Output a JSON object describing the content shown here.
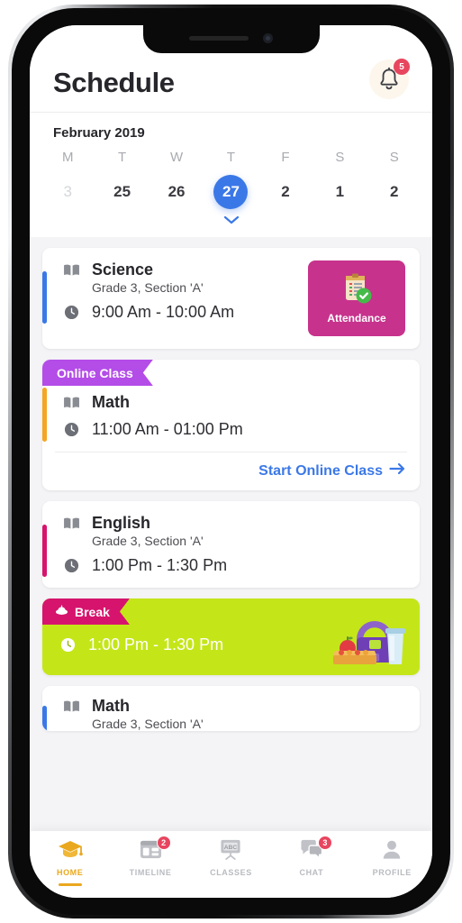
{
  "header": {
    "title": "Schedule",
    "bell_icon": "bell-icon",
    "notification_count": "5"
  },
  "calendar": {
    "month_label": "February 2019",
    "day_initials": [
      "M",
      "T",
      "W",
      "T",
      "F",
      "S",
      "S"
    ],
    "dates": [
      {
        "label": "3",
        "state": "muted"
      },
      {
        "label": "25",
        "state": "normal"
      },
      {
        "label": "26",
        "state": "normal"
      },
      {
        "label": "27",
        "state": "selected"
      },
      {
        "label": "2",
        "state": "normal"
      },
      {
        "label": "1",
        "state": "normal"
      },
      {
        "label": "2",
        "state": "normal"
      }
    ],
    "expand_icon": "chevron-down-icon",
    "selected_color": "#3b78e7"
  },
  "schedule": {
    "items": [
      {
        "subject": "Science",
        "section": "Grade 3, Section 'A'",
        "time": "9:00 Am - 10:00 Am",
        "accent_color": "#3b78e7",
        "action": {
          "label": "Attendance",
          "icon": "clipboard-check-icon",
          "color": "#c7328c"
        }
      },
      {
        "ribbon": {
          "label": "Online Class",
          "color": "#b44ce8"
        },
        "subject": "Math",
        "time": "11:00 Am - 01:00 Pm",
        "accent_color": "#f5a623",
        "link": {
          "label": "Start Online Class",
          "icon": "arrow-right-icon",
          "color": "#3b78e7"
        }
      },
      {
        "subject": "English",
        "section": "Grade 3, Section 'A'",
        "time": "1:00 Pm - 1:30 Pm",
        "accent_color": "#d6146d"
      },
      {
        "ribbon": {
          "label": "Break",
          "color": "#d6146d",
          "icon": "food-icon"
        },
        "time": "1:00 Pm - 1:30 Pm",
        "background_color": "#c4e619",
        "art": "lunchbox-illustration"
      },
      {
        "subject": "Math",
        "section": "Grade 3, Section 'A'",
        "accent_color": "#3b78e7"
      }
    ],
    "book_icon": "book-icon",
    "clock_icon": "clock-icon"
  },
  "bottom_nav": {
    "items": [
      {
        "label": "HOME",
        "icon": "graduation-cap-icon",
        "active": true,
        "badge": ""
      },
      {
        "label": "TIMELINE",
        "icon": "timeline-icon",
        "active": false,
        "badge": "2"
      },
      {
        "label": "CLASSES",
        "icon": "chalkboard-abc-icon",
        "active": false,
        "badge": ""
      },
      {
        "label": "CHAT",
        "icon": "chat-bubbles-icon",
        "active": false,
        "badge": "3"
      },
      {
        "label": "PROFILE",
        "icon": "person-icon",
        "active": false,
        "badge": ""
      }
    ],
    "active_color": "#eaa81e",
    "inactive_color": "#b9bbc0"
  }
}
